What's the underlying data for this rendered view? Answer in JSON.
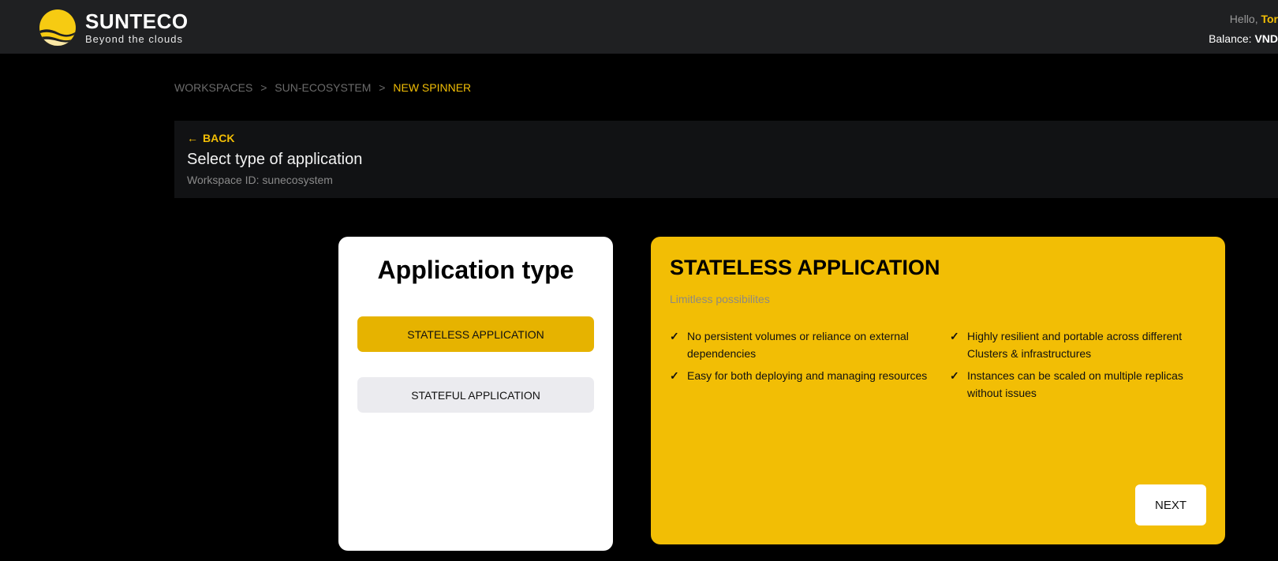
{
  "header": {
    "brand": "SUNTECO",
    "tagline": "Beyond the clouds",
    "greeting": "Hello,",
    "user_name": "Tor",
    "balance_label": "Balance:",
    "balance_value": "VND"
  },
  "breadcrumb": [
    "WORKSPACES",
    ">",
    "SUN-ECOSYSTEM",
    ">",
    "NEW SPINNER"
  ],
  "panel": {
    "back_label": "BACK",
    "title": "Select type of application",
    "workspace_id": "Workspace ID: sunecosystem"
  },
  "app_type": {
    "heading": "Application type",
    "options": [
      "STATELESS APPLICATION",
      "STATEFUL APPLICATION"
    ],
    "selected": "STATELESS APPLICATION"
  },
  "detail": {
    "title": "STATELESS APPLICATION",
    "subtitle": "Limitless possibilites",
    "features": [
      "No persistent volumes or reliance on external dependencies",
      "Highly resilient and portable across different Clusters & infrastructures",
      "Easy for both deploying and managing resources",
      "Instances can be scaled on multiple replicas without issues"
    ],
    "next_label": "NEXT"
  },
  "colors": {
    "accent": "#f2be05",
    "header_bg": "#1f2022"
  }
}
